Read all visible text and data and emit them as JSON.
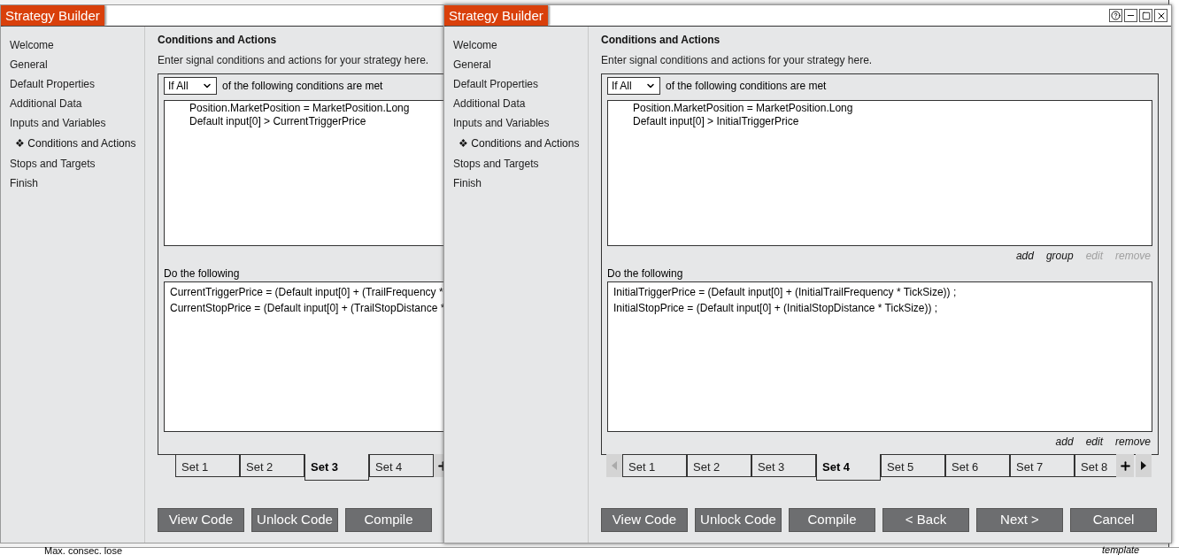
{
  "windows": [
    {
      "title": "Strategy Builder",
      "window_controls": false,
      "sidebar_marker": "❖",
      "sidebar": [
        {
          "label": "Welcome",
          "selected": false
        },
        {
          "label": "General",
          "selected": false
        },
        {
          "label": "Default Properties",
          "selected": false
        },
        {
          "label": "Additional Data",
          "selected": false
        },
        {
          "label": "Inputs and Variables",
          "selected": false
        },
        {
          "label": "Conditions and Actions",
          "selected": true
        },
        {
          "label": "Stops and Targets",
          "selected": false
        },
        {
          "label": "Finish",
          "selected": false
        }
      ],
      "heading": "Conditions and Actions",
      "description": "Enter signal conditions and actions for your strategy here.",
      "match_mode": "If All",
      "match_suffix": "of the following conditions are met",
      "conditions": [
        "Position.MarketPosition = MarketPosition.Long",
        "Default input[0] > CurrentTriggerPrice"
      ],
      "actions_label": "Do the following",
      "actions": [
        "CurrentTriggerPrice = (Default input[0] + (TrailFrequency *",
        "CurrentStopPrice = (Default input[0] + (TrailStopDistance *"
      ],
      "tabs": [
        {
          "label": "Set 1",
          "selected": false
        },
        {
          "label": "Set 2",
          "selected": false
        },
        {
          "label": "Set 3",
          "selected": true
        },
        {
          "label": "Set 4",
          "selected": false
        }
      ],
      "buttons": [
        "View Code",
        "Unlock Code",
        "Compile"
      ]
    },
    {
      "title": "Strategy Builder",
      "window_controls": true,
      "sidebar_marker": "❖",
      "sidebar": [
        {
          "label": "Welcome",
          "selected": false
        },
        {
          "label": "General",
          "selected": false
        },
        {
          "label": "Default Properties",
          "selected": false
        },
        {
          "label": "Additional Data",
          "selected": false
        },
        {
          "label": "Inputs and Variables",
          "selected": false
        },
        {
          "label": "Conditions and Actions",
          "selected": true
        },
        {
          "label": "Stops and Targets",
          "selected": false
        },
        {
          "label": "Finish",
          "selected": false
        }
      ],
      "heading": "Conditions and Actions",
      "description": "Enter signal conditions and actions for your strategy here.",
      "match_mode": "If All",
      "match_suffix": "of the following conditions are met",
      "conditions": [
        "Position.MarketPosition = MarketPosition.Long",
        "Default input[0] > InitialTriggerPrice"
      ],
      "condition_links": [
        {
          "label": "add",
          "disabled": false
        },
        {
          "label": "group",
          "disabled": false
        },
        {
          "label": "edit",
          "disabled": true
        },
        {
          "label": "remove",
          "disabled": true
        }
      ],
      "actions_label": "Do the following",
      "actions": [
        "InitialTriggerPrice = (Default input[0] + (InitialTrailFrequency * TickSize)) ;",
        "InitialStopPrice = (Default input[0] + (InitialStopDistance * TickSize)) ;"
      ],
      "action_links": [
        {
          "label": "add",
          "disabled": false
        },
        {
          "label": "edit",
          "disabled": false
        },
        {
          "label": "remove",
          "disabled": false
        }
      ],
      "tabs": [
        {
          "label": "Set 1",
          "selected": false
        },
        {
          "label": "Set 2",
          "selected": false
        },
        {
          "label": "Set 3",
          "selected": false
        },
        {
          "label": "Set 4",
          "selected": true
        },
        {
          "label": "Set 5",
          "selected": false
        },
        {
          "label": "Set 6",
          "selected": false
        },
        {
          "label": "Set 7",
          "selected": false
        },
        {
          "label": "Set 8",
          "selected": false
        }
      ],
      "buttons": [
        "View Code",
        "Unlock Code",
        "Compile",
        "< Back",
        "Next >",
        "Cancel"
      ]
    }
  ],
  "background_texts": [
    {
      "text": "Max. consec. lose",
      "kind": "plain"
    },
    {
      "text": "template",
      "kind": "italic"
    }
  ]
}
